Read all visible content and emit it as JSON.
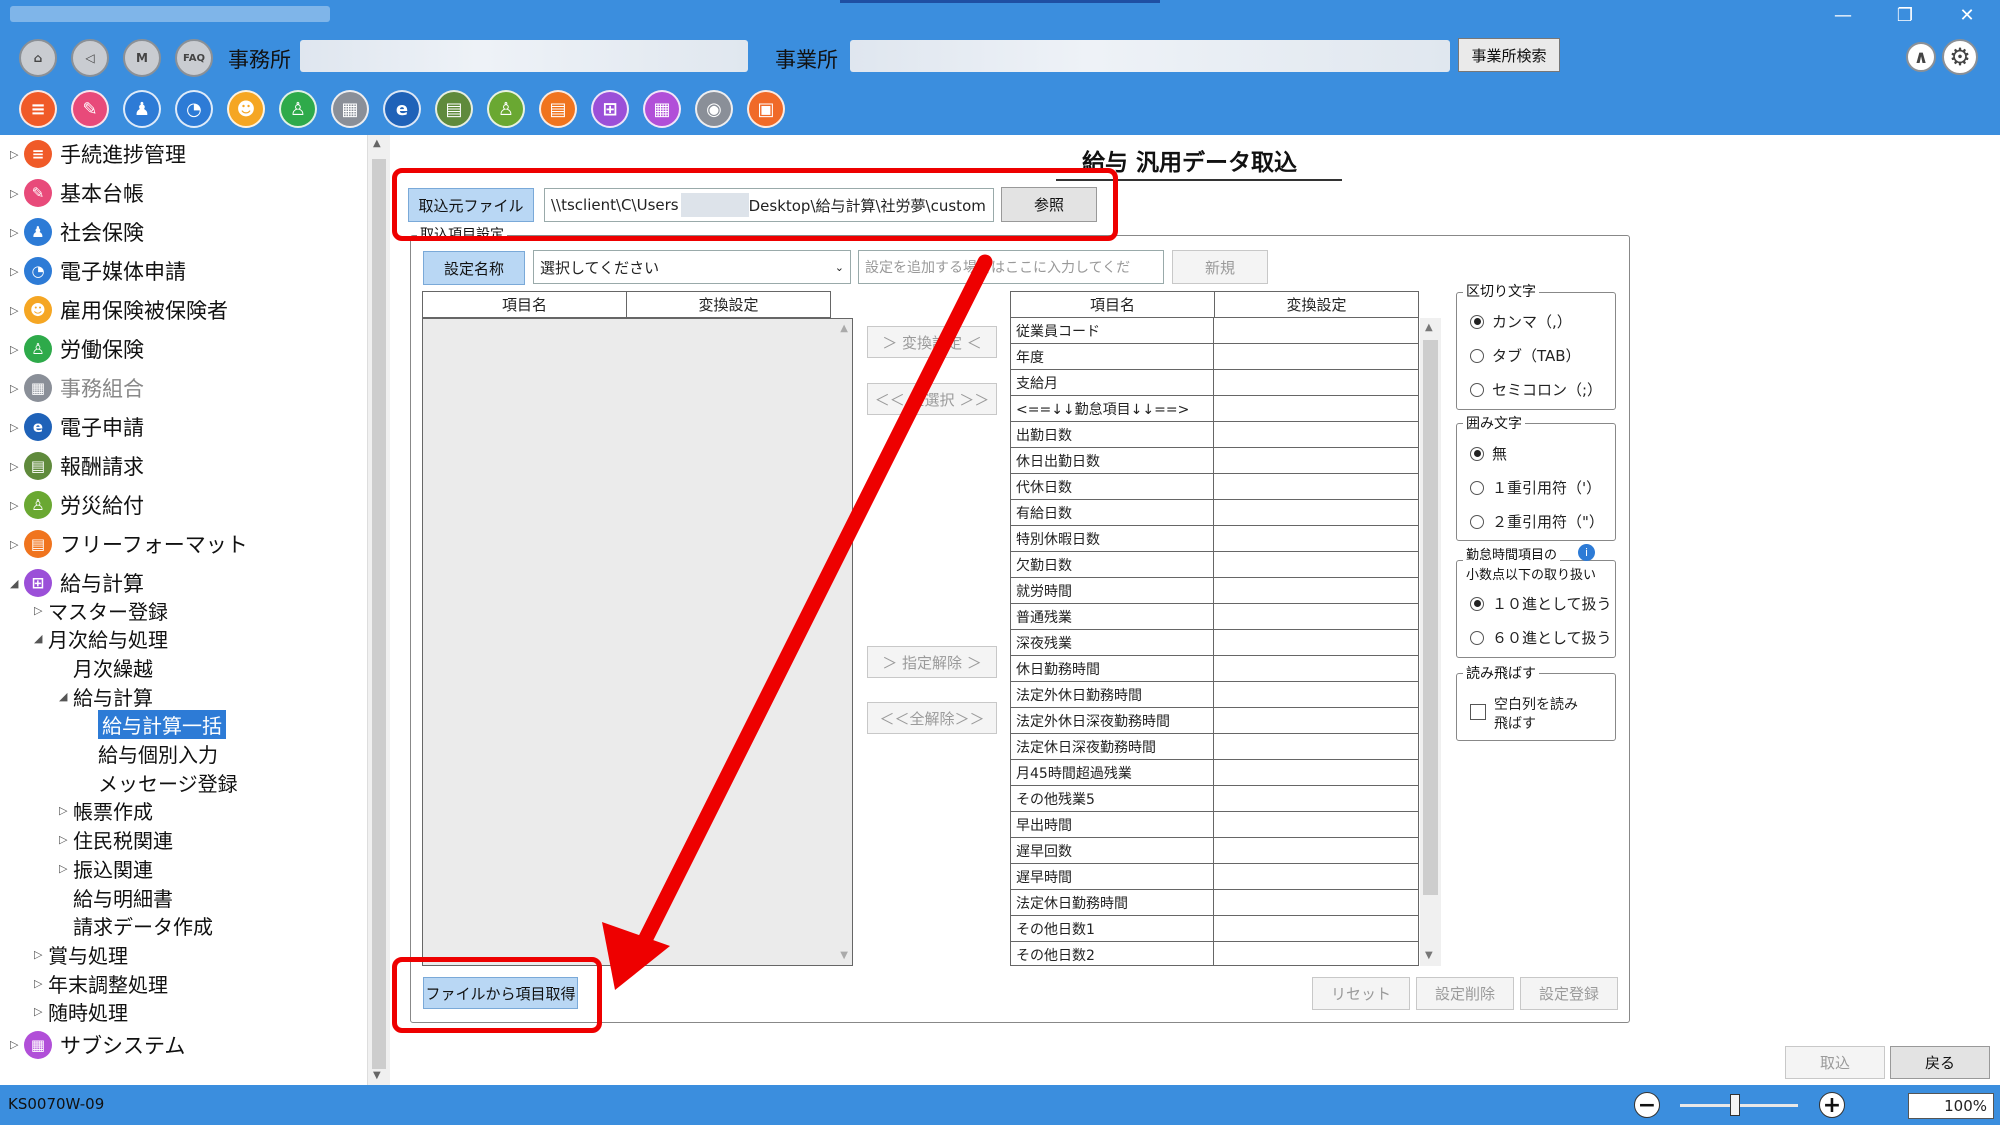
{
  "window": {
    "controls": [
      "—",
      "❐",
      "✕"
    ]
  },
  "header": {
    "nav_buttons": [
      {
        "name": "home-icon",
        "glyph": "⌂"
      },
      {
        "name": "back-icon",
        "glyph": "◁"
      },
      {
        "name": "m-icon",
        "glyph": "M"
      },
      {
        "name": "faq-icon",
        "glyph": "FAQ"
      }
    ],
    "office_label": "事務所",
    "site_label": "事業所",
    "office_search_label": "事業所検索",
    "collapse_glyph": "∧",
    "settings_glyph": "⚙"
  },
  "apps": [
    {
      "name": "procedure-app-icon",
      "color": "#f05a28",
      "glyph": "≡"
    },
    {
      "name": "ledger-app-icon",
      "color": "#e84a7a",
      "glyph": "✎"
    },
    {
      "name": "social-insurance-app-icon",
      "color": "#2d7bd6",
      "glyph": "♟"
    },
    {
      "name": "media-app-icon",
      "color": "#2d7bd6",
      "glyph": "◔"
    },
    {
      "name": "employment-app-icon",
      "color": "#f5a623",
      "glyph": "☻"
    },
    {
      "name": "labor-app-icon",
      "color": "#2eaa4a",
      "glyph": "♙"
    },
    {
      "name": "association-app-icon",
      "color": "#8a8f98",
      "glyph": "▦"
    },
    {
      "name": "e-application-app-icon",
      "color": "#1f62b8",
      "glyph": "e"
    },
    {
      "name": "remuneration-app-icon",
      "color": "#5f8a3c",
      "glyph": "▤"
    },
    {
      "name": "accident-app-icon",
      "color": "#6aa832",
      "glyph": "♙"
    },
    {
      "name": "free-format-app-icon",
      "color": "#f0741e",
      "glyph": "▤"
    },
    {
      "name": "payroll-app-icon",
      "color": "#9b4fd8",
      "glyph": "⊞"
    },
    {
      "name": "subsystem-app-icon",
      "color": "#b14fd8",
      "glyph": "▦"
    },
    {
      "name": "camera-app-icon",
      "color": "#8a8f98",
      "glyph": "◉"
    },
    {
      "name": "bag-app-icon",
      "color": "#f06a28",
      "glyph": "▣"
    }
  ],
  "sidebar": {
    "items": [
      {
        "label": "手続進捗管理",
        "color": "#f05a28",
        "glyph": "≡",
        "arrow": "▷",
        "muted": false
      },
      {
        "label": "基本台帳",
        "color": "#e84a7a",
        "glyph": "✎",
        "arrow": "▷",
        "muted": false
      },
      {
        "label": "社会保険",
        "color": "#2d7bd6",
        "glyph": "♟",
        "arrow": "▷",
        "muted": false
      },
      {
        "label": "電子媒体申請",
        "color": "#2d7bd6",
        "glyph": "◔",
        "arrow": "▷",
        "muted": false
      },
      {
        "label": "雇用保険被保険者",
        "color": "#f5a623",
        "glyph": "☻",
        "arrow": "▷",
        "muted": false
      },
      {
        "label": "労働保険",
        "color": "#2eaa4a",
        "glyph": "♙",
        "arrow": "▷",
        "muted": false
      },
      {
        "label": "事務組合",
        "color": "#8a8f98",
        "glyph": "▦",
        "arrow": "▷",
        "muted": true
      },
      {
        "label": "電子申請",
        "color": "#1f62b8",
        "glyph": "e",
        "arrow": "▷",
        "muted": false
      },
      {
        "label": "報酬請求",
        "color": "#5f8a3c",
        "glyph": "▤",
        "arrow": "▷",
        "muted": false
      },
      {
        "label": "労災給付",
        "color": "#6aa832",
        "glyph": "♙",
        "arrow": "▷",
        "muted": false
      },
      {
        "label": "フリーフォーマット",
        "color": "#f0741e",
        "glyph": "▤",
        "arrow": "▷",
        "muted": false
      },
      {
        "label": "給与計算",
        "color": "#9b4fd8",
        "glyph": "⊞",
        "arrow": "◢",
        "muted": false
      }
    ],
    "payroll_children": [
      {
        "label": "マスター登録",
        "arrow": "▷",
        "indent": 1
      },
      {
        "label": "月次給与処理",
        "arrow": "◢",
        "indent": 1
      },
      {
        "label": "月次繰越",
        "arrow": "",
        "indent": 2
      },
      {
        "label": "給与計算",
        "arrow": "◢",
        "indent": 2
      },
      {
        "label": "給与計算一括",
        "arrow": "",
        "indent": 3,
        "selected": true
      },
      {
        "label": "給与個別入力",
        "arrow": "",
        "indent": 3
      },
      {
        "label": "メッセージ登録",
        "arrow": "",
        "indent": 3
      },
      {
        "label": "帳票作成",
        "arrow": "▷",
        "indent": 2
      },
      {
        "label": "住民税関連",
        "arrow": "▷",
        "indent": 2
      },
      {
        "label": "振込関連",
        "arrow": "▷",
        "indent": 2
      },
      {
        "label": "給与明細書",
        "arrow": "",
        "indent": 2
      },
      {
        "label": "請求データ作成",
        "arrow": "",
        "indent": 2
      },
      {
        "label": "賞与処理",
        "arrow": "▷",
        "indent": 1
      },
      {
        "label": "年末調整処理",
        "arrow": "▷",
        "indent": 1
      },
      {
        "label": "随時処理",
        "arrow": "▷",
        "indent": 1
      }
    ],
    "subsystem": {
      "label": "サブシステム",
      "color": "#b14fd8",
      "glyph": "▦",
      "arrow": "▷"
    }
  },
  "main": {
    "title": "給与 汎用データ取込",
    "source_file_button": "取込元ファイル",
    "source_path_prefix": "\\\\tsclient\\C\\Users",
    "source_path_suffix": "Desktop\\給与計算\\社労夢\\custom",
    "browse_button": "参照",
    "import_settings_group": "取込項目設定",
    "setting_name_button": "設定名称",
    "setting_select_value": "選択してください",
    "new_setting_placeholder": "設定を追加する場合はここに入力してくだ",
    "new_button": "新規",
    "left_table_headers": [
      "項目名",
      "変換設定"
    ],
    "right_table_headers": [
      "項目名",
      "変換設定"
    ],
    "convert_button": "＞ 変換設定 ＜",
    "select_all_button": "＜＜ 全選択 ＞＞",
    "deselect_button": "＞ 指定解除 ＞",
    "deselect_all_button": "＜＜全解除＞＞",
    "right_rows": [
      "従業員コード",
      "年度",
      "支給月",
      "<==↓↓勤怠項目↓↓==>",
      "出勤日数",
      "休日出勤日数",
      "代休日数",
      "有給日数",
      "特別休暇日数",
      "欠勤日数",
      "就労時間",
      "普通残業",
      "深夜残業",
      "休日勤務時間",
      "法定外休日勤務時間",
      "法定外休日深夜勤務時間",
      "法定休日深夜勤務時間",
      "月45時間超過残業",
      "その他残業5",
      "早出時間",
      "遅早回数",
      "遅早時間",
      "法定休日勤務時間",
      "その他日数1",
      "その他日数2"
    ],
    "get_items_button": "ファイルから項目取得",
    "reset_button": "リセット",
    "delete_setting_button": "設定削除",
    "register_setting_button": "設定登録",
    "delimiter": {
      "label": "区切り文字",
      "options": [
        "カンマ（,）",
        "タブ（TAB）",
        "セミコロン（;）"
      ],
      "selected": 0
    },
    "quote": {
      "label": "囲み文字",
      "options": [
        "無",
        "１重引用符（'）",
        "２重引用符（\"）"
      ],
      "selected": 0
    },
    "decimal": {
      "label_line1": "勤怠時間項目の",
      "label_line2": "小数点以下の取り扱い",
      "options": [
        "１０進として扱う",
        "６０進として扱う"
      ],
      "selected": 0
    },
    "skip": {
      "label": "読み飛ばす",
      "checkbox_label_1": "空白列を読み",
      "checkbox_label_2": "飛ばす"
    },
    "import_button": "取込",
    "back_button": "戻る"
  },
  "status": {
    "code": "KS0070W-09",
    "zoom": "100%",
    "zoom_level": 0.5
  },
  "colors": {
    "accent": "#3b8ede",
    "highlight": "#ee0000",
    "button_blue": "#b9d7f4",
    "selection": "#2d7bd6"
  }
}
